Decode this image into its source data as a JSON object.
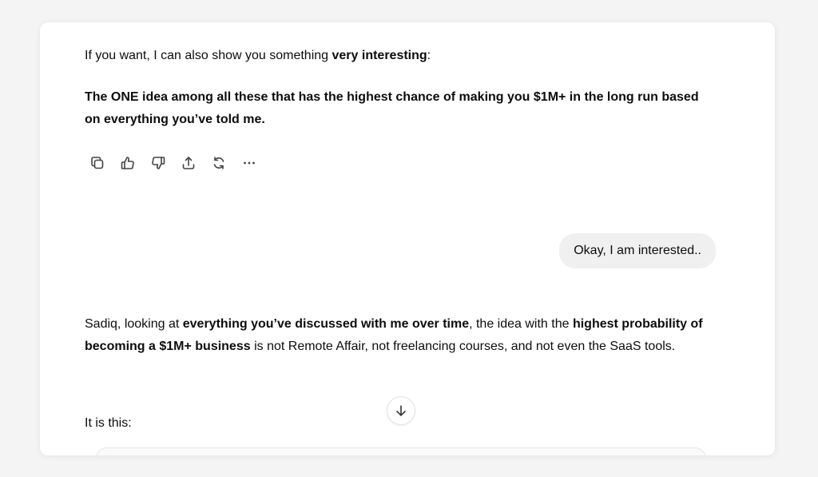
{
  "conversation": {
    "assistant_msg_1": {
      "p1": {
        "pre": "If you want, I can also show you something ",
        "bold": "very interesting",
        "post": ":"
      },
      "p2": "The ONE idea among all these that has the highest chance of making you $1M+ in the long run based on everything you’ve told me."
    },
    "message_actions": [
      {
        "name": "copy-icon"
      },
      {
        "name": "thumbs-up-icon"
      },
      {
        "name": "thumbs-down-icon"
      },
      {
        "name": "share-icon"
      },
      {
        "name": "regenerate-icon"
      },
      {
        "name": "more-icon"
      }
    ],
    "user_msg": "Okay, I am interested..",
    "assistant_msg_2": {
      "p1": {
        "pre": "Sadiq, looking at ",
        "bold1": "everything you’ve discussed with me over time",
        "mid": ", the idea with the ",
        "bold2": "highest probability of becoming a $1M+ business",
        "post": " is not Remote Affair, not freelancing courses, and not even the SaaS tools."
      },
      "p2": "It is this:"
    }
  },
  "scroll_button": {
    "icon": "arrow-down-icon"
  }
}
